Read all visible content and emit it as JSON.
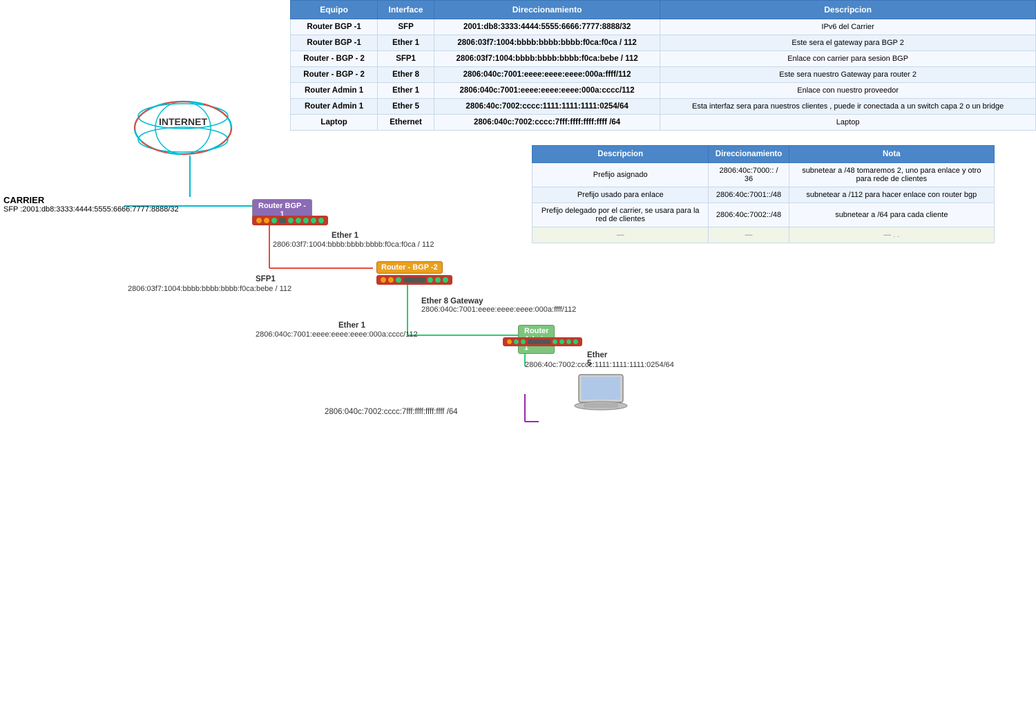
{
  "table": {
    "headers": [
      "Equipo",
      "Interface",
      "Direccionamiento",
      "Descripcion"
    ],
    "rows": [
      {
        "equipo": "Router BGP -1",
        "interface": "SFP",
        "dir": "2001:db8:3333:4444:5555:6666:7777:8888/32",
        "desc": "IPv6 del Carrier"
      },
      {
        "equipo": "Router BGP -1",
        "interface": "Ether 1",
        "dir": "2806:03f7:1004:bbbb:bbbb:bbbb:f0ca:f0ca / 112",
        "desc": "Este sera el gateway para BGP 2"
      },
      {
        "equipo": "Router - BGP - 2",
        "interface": "SFP1",
        "dir": "2806:03f7:1004:bbbb:bbbb:bbbb:f0ca:bebe / 112",
        "desc": "Enlace con carrier para sesion BGP"
      },
      {
        "equipo": "Router - BGP - 2",
        "interface": "Ether 8",
        "dir": "2806:040c:7001:eeee:eeee:eeee:000a:ffff/112",
        "desc": "Este sera nuestro Gateway para router 2"
      },
      {
        "equipo": "Router Admin 1",
        "interface": "Ether 1",
        "dir": "2806:040c:7001:eeee:eeee:eeee:000a:cccc/112",
        "desc": "Enlace con nuestro proveedor"
      },
      {
        "equipo": "Router Admin 1",
        "interface": "Ether 5",
        "dir": "2806:40c:7002:cccc:1111:1111:1111:0254/64",
        "desc": "Esta interfaz sera para nuestros clientes , puede ir conectada a un switch capa 2 o un bridge"
      },
      {
        "equipo": "Laptop",
        "interface": "Ethernet",
        "dir": "2806:040c:7002:cccc:7fff:ffff:ffff:ffff /64",
        "desc": "Laptop"
      }
    ]
  },
  "table2": {
    "headers": [
      "Descripcion",
      "Direccionamiento",
      "Nota"
    ],
    "rows": [
      {
        "desc": "Prefijo asignado",
        "dir": "2806:40c:7000:: / 36",
        "nota": "subnetear a /48  tomaremos 2, uno para enlace y otro para rede de clientes"
      },
      {
        "desc": "Prefijo usado para enlace",
        "dir": "2806:40c:7001::/48",
        "nota": "subnetear a /112 para hacer enlace con router bgp"
      },
      {
        "desc": "Prefijo delegado por el carrier, se usara para la red de clientes",
        "dir": "2806:40c:7002::/48",
        "nota": "subnetear a /64 para cada cliente"
      },
      {
        "desc": "—",
        "dir": "—",
        "nota": "— . ."
      }
    ]
  },
  "diagram": {
    "internet_label": "INTERNET",
    "carrier_label": "CARRIER",
    "carrier_sfp": "SFP :2001:db8:3333:4444:5555:6666:7777:8888/32",
    "router_bgp1_label": "Router BGP -\n1",
    "ether1_bgp1_label": "Ether 1",
    "ether1_bgp1_addr": "2806:03f7:1004:bbbb:bbbb:bbbb:f0ca:f0ca / 112",
    "router_bgp2_label": "Router - BGP -2",
    "sfp1_label": "SFP1",
    "sfp1_addr": "2806:03f7:1004:bbbb:bbbb:bbbb:f0ca:bebe / 112",
    "ether8_label": "Ether 8 Gateway",
    "ether8_addr": "2806:040c:7001:eeee:eeee:eeee:000a:ffff/112",
    "router_admin1_label": "Router Admin 1",
    "ether1_admin_label": "Ether 1",
    "ether1_admin_addr": "2806:040c:7001:eeee:eeee:eeee:000a:cccc/112",
    "ether5_label": "Ether 5",
    "ether5_addr": "2806:40c:7002:cccc:1111:1111:1111:0254/64",
    "laptop_addr": "2806:040c:7002:cccc:7fff:ffff:ffff:ffff /64"
  }
}
